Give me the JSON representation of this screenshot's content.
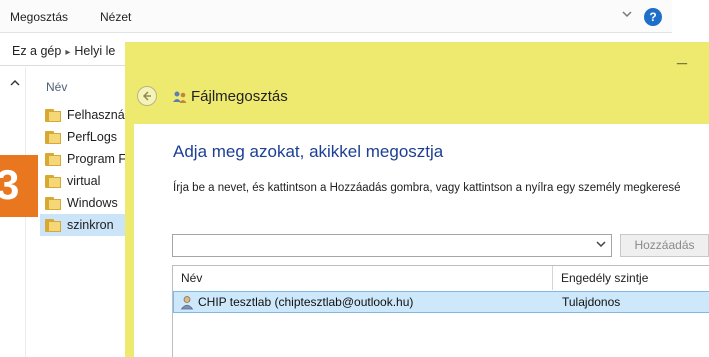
{
  "explorer": {
    "ribbon_tabs": [
      "Megosztás",
      "Nézet"
    ],
    "address": {
      "part1": "Ez a gép",
      "part2": "Helyi le"
    },
    "column_header": "Név",
    "folders": [
      {
        "name": "Felhasznál",
        "selected": false
      },
      {
        "name": "PerfLogs",
        "selected": false
      },
      {
        "name": "Program F",
        "selected": false
      },
      {
        "name": "virtual",
        "selected": false
      },
      {
        "name": "Windows",
        "selected": false
      },
      {
        "name": "szinkron",
        "selected": true
      }
    ],
    "badge_label": "3",
    "badge_color": "#e8771f"
  },
  "dialog": {
    "title": "Fájlmegosztás",
    "minimize_glyph": "_",
    "heading": "Adja meg azokat, akikkel megosztja",
    "instructions": "Írja be a nevet, és kattintson a Hozzáadás gombra, vagy kattintson a nyílra egy személy megkeresé",
    "combo_value": "",
    "add_button": "Hozzáadás",
    "table": {
      "columns": [
        "Név",
        "Engedély szintje"
      ],
      "rows": [
        {
          "name": "CHIP tesztlab (chiptesztlab@outlook.hu)",
          "permission": "Tulajdonos"
        }
      ]
    },
    "accent_color": "#eeea70"
  }
}
